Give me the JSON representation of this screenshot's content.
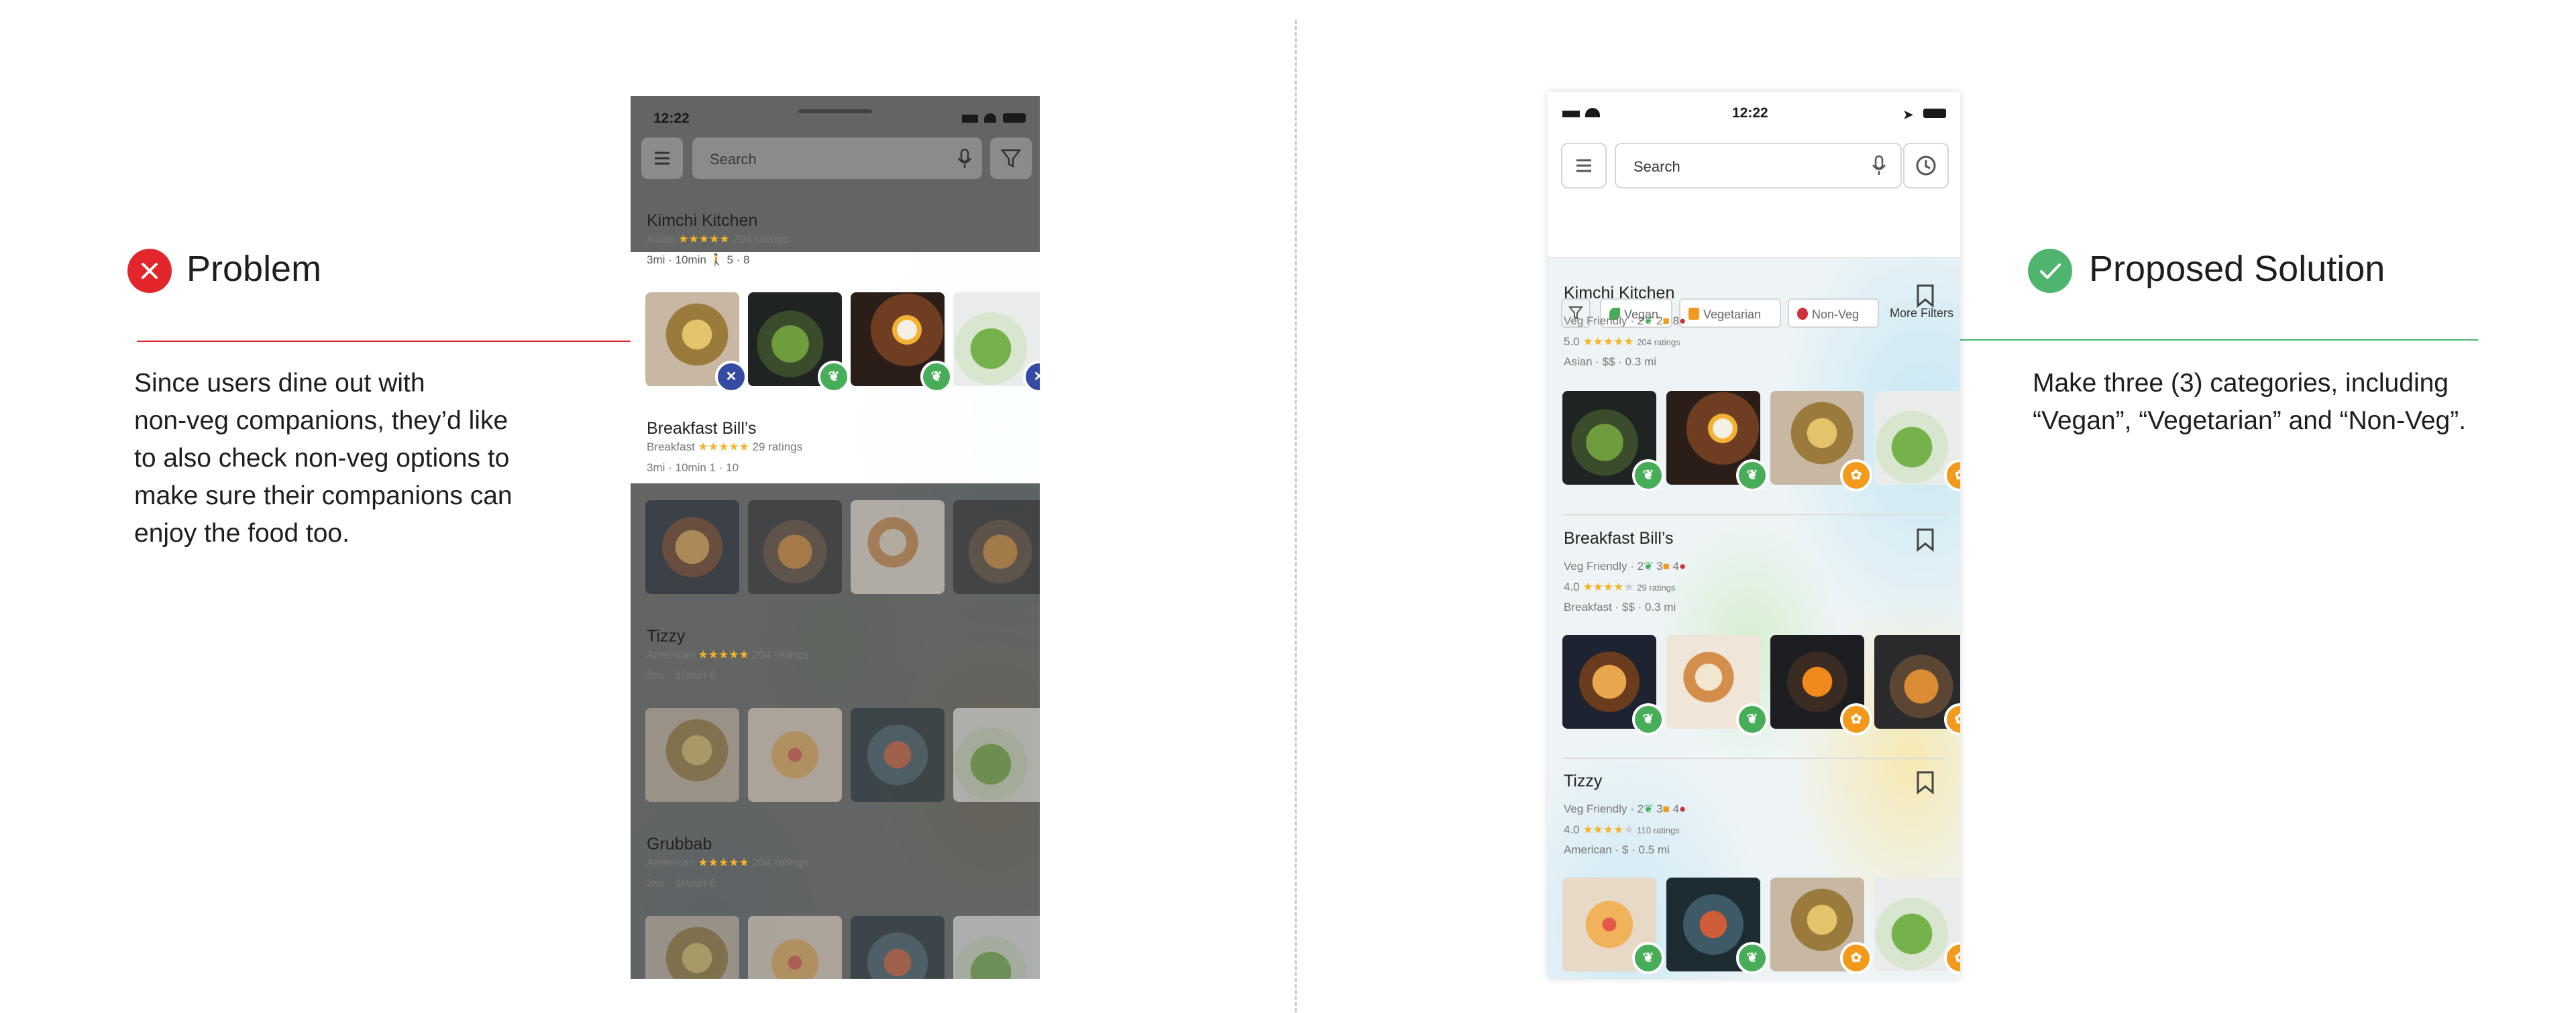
{
  "problem": {
    "title": "Problem",
    "lines": [
      "Since users dine out with",
      "non-veg companions, they’d like",
      "to also check non-veg options to",
      "make sure their companions can",
      "enjoy the food too."
    ]
  },
  "solution": {
    "title": "Proposed Solution",
    "lines": [
      "Make three (3) categories, including",
      "“Vegan”, “Vegetarian” and “Non-Veg”."
    ]
  },
  "left_phone": {
    "time": "12:22",
    "search_placeholder": "Search",
    "restaurants": [
      {
        "name": "Kimchi Kitchen",
        "meta": "Asian",
        "ratings": "204 ratings",
        "info": "3mi · 10min",
        "counts": "5 · 8"
      },
      {
        "name": "Breakfast Bill’s",
        "meta": "Breakfast",
        "ratings": "29 ratings",
        "info": "3mi · 10min",
        "counts": "1 · 10"
      },
      {
        "name": "Tizzy",
        "meta": "American",
        "ratings": "204 ratings",
        "info": "3mi · 10min",
        "counts": "6"
      },
      {
        "name": "Grubbab",
        "meta": "American",
        "ratings": "204 ratings",
        "info": "3mi · 10min",
        "counts": "6"
      }
    ]
  },
  "right_phone": {
    "time": "12:22",
    "search_placeholder": "Search",
    "chips": {
      "vegan": "Vegan",
      "vegetarian": "Vegetarian",
      "nonveg": "Non-Veg",
      "more": "More Filters"
    },
    "restaurants": [
      {
        "name": "Kimchi Kitchen",
        "friendly": "Veg Friendly",
        "vegan": "2",
        "veg": "2",
        "nonveg": "8",
        "rating": "5.0",
        "ratings": "204 ratings",
        "cuisine": "Asian",
        "price": "$$",
        "distance": "0.3 mi"
      },
      {
        "name": "Breakfast Bill’s",
        "friendly": "Veg Friendly",
        "vegan": "2",
        "veg": "3",
        "nonveg": "4",
        "rating": "4.0",
        "ratings": "29 ratings",
        "cuisine": "Breakfast",
        "price": "$$",
        "distance": "0.3 mi"
      },
      {
        "name": "Tizzy",
        "friendly": "Veg Friendly",
        "vegan": "2",
        "veg": "3",
        "nonveg": "4",
        "rating": "4.0",
        "ratings": "110 ratings",
        "cuisine": "American",
        "price": "$",
        "distance": "0.5 mi"
      }
    ]
  },
  "colors": {
    "problem": "#e3262b",
    "solution": "#4fb56e",
    "vegan": "#47ad58",
    "vegetarian": "#f39a1d",
    "nonveg": "#d0313b",
    "star": "#f5b326"
  }
}
